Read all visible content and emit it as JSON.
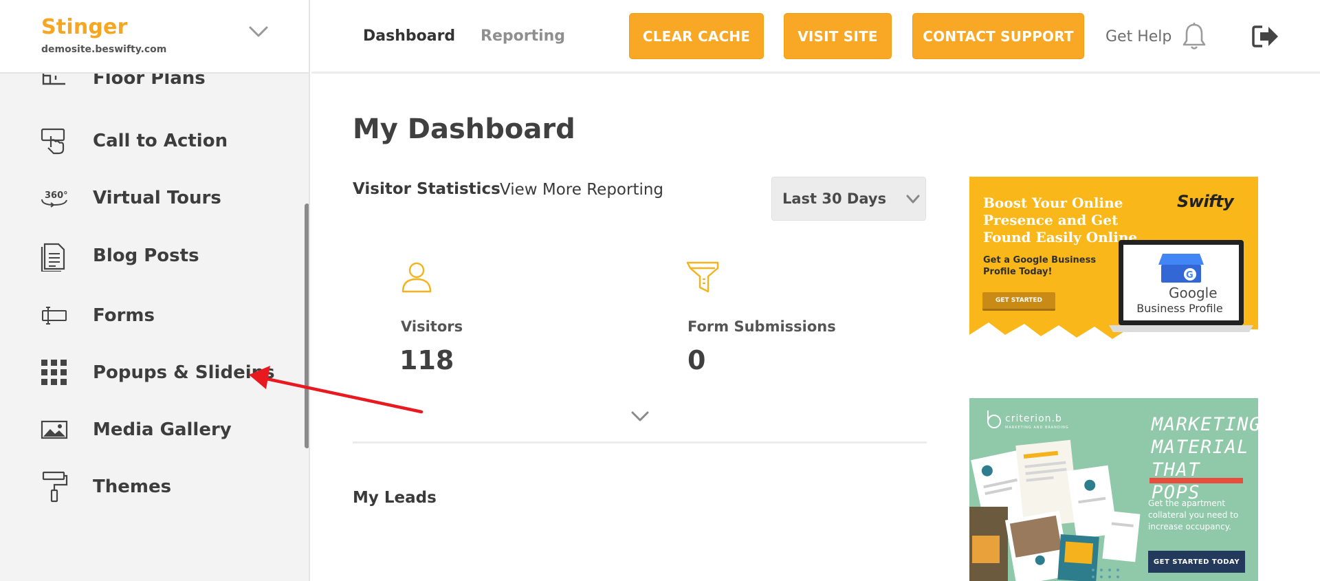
{
  "brand": {
    "name": "Stinger",
    "domain": "demosite.beswifty.com"
  },
  "sidebar": {
    "items": [
      {
        "label": "Floor Plans",
        "icon": "floor-plan-icon"
      },
      {
        "label": "Call to Action",
        "icon": "pointer-hand-icon"
      },
      {
        "label": "Virtual Tours",
        "icon": "360-tour-icon"
      },
      {
        "label": "Blog Posts",
        "icon": "document-icon"
      },
      {
        "label": "Forms",
        "icon": "form-field-icon"
      },
      {
        "label": "Popups & Slideins",
        "icon": "grid-icon"
      },
      {
        "label": "Media Gallery",
        "icon": "image-icon"
      },
      {
        "label": "Themes",
        "icon": "paint-roller-icon"
      }
    ]
  },
  "header": {
    "tabs": [
      "Dashboard",
      "Reporting"
    ],
    "buttons": {
      "clear_cache": "CLEAR CACHE",
      "visit_site": "VISIT SITE",
      "contact_support": "CONTACT SUPPORT"
    },
    "get_help": "Get Help",
    "icons": [
      "bell-icon",
      "logout-icon"
    ]
  },
  "main": {
    "title": "My Dashboard",
    "stats_title": "Visitor Statistics",
    "view_more": "View More Reporting",
    "range": "Last 30 Days",
    "stats": [
      {
        "label": "Visitors",
        "value": "118",
        "icon": "user-icon"
      },
      {
        "label": "Form Submissions",
        "value": "0",
        "icon": "funnel-icon"
      }
    ],
    "leads_title": "My Leads"
  },
  "ads": {
    "google": {
      "headline": "Boost Your Online Presence and Get Found Easily Online",
      "sub": "Get a Google Business Profile Today!",
      "cta": "GET STARTED",
      "brand": "Swifty",
      "google_word": "Google",
      "product": "Business Profile"
    },
    "criterion": {
      "logo": "criterion.b",
      "tagline": "MARKETING AND BRANDING",
      "headline": "MARKETING MATERIAL THAT POPS",
      "body": "Get the apartment collateral you need to increase occupancy.",
      "cta": "GET STARTED TODAY"
    }
  },
  "colors": {
    "accent": "#f9a825",
    "brand_text": "#f5a623",
    "annotation_arrow": "#e8191f",
    "ad1_bg": "#f9b71a",
    "ad2_bg": "#8fc9a9"
  }
}
